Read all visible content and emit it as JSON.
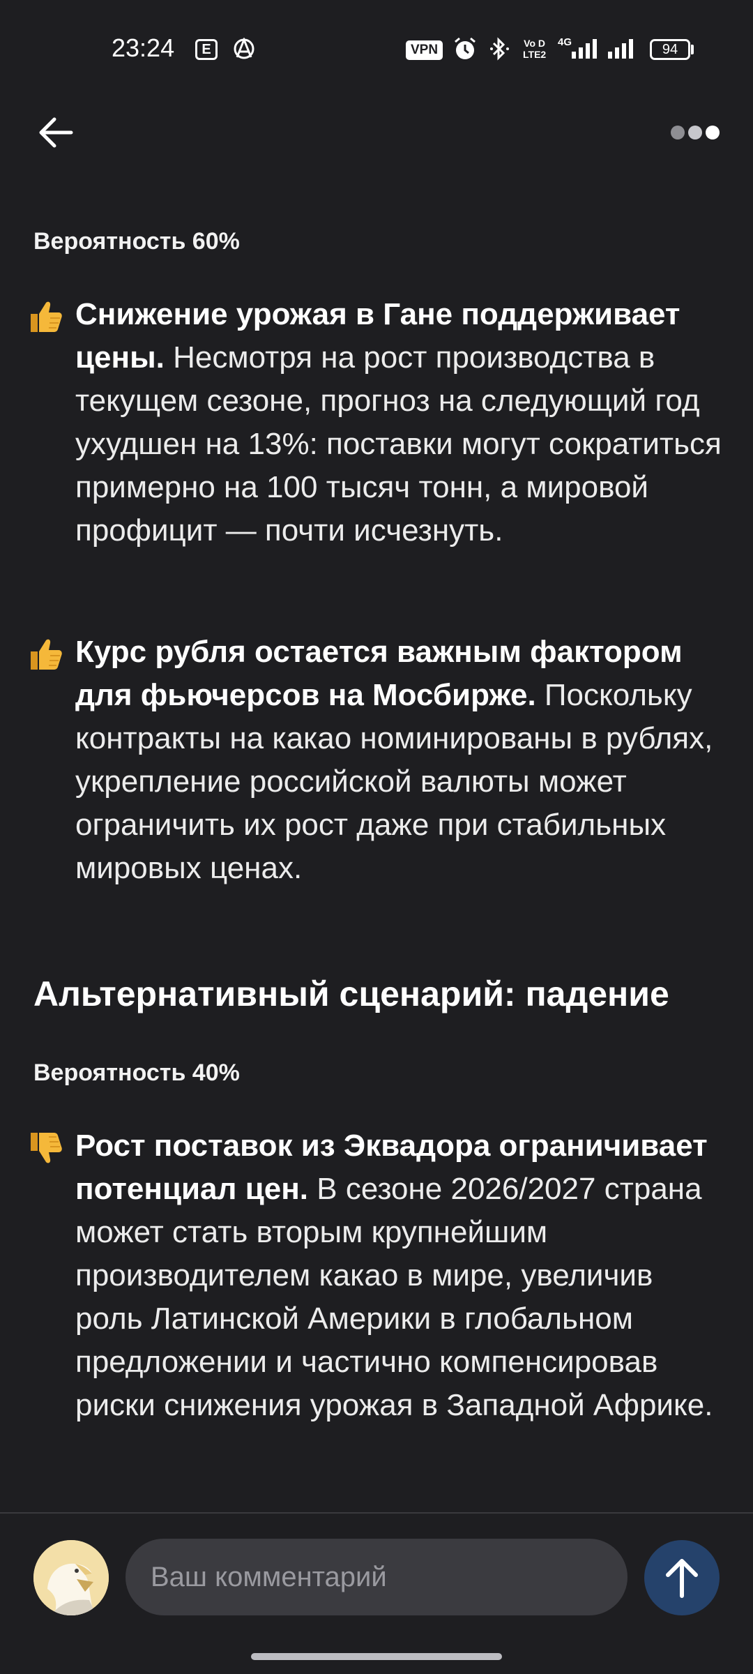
{
  "status_bar": {
    "time": "23:24",
    "notif_e": "E",
    "vpn": "VPN",
    "volte_top": "Vo D",
    "volte_bottom": "LTE2",
    "network": "4G",
    "battery": "94"
  },
  "icons": {
    "back": "arrow-left-icon",
    "more": "more-dots-icon",
    "thumbs_up": "thumbs-up-icon",
    "thumbs_down": "thumbs-down-icon",
    "send": "arrow-up-icon"
  },
  "article": {
    "probability_1": "Вероятность 60%",
    "points_up": [
      {
        "bold": "Снижение урожая в Гане поддерживает цены.",
        "text": " Несмотря на рост производства в текущем сезоне, прогноз на следующий год ухудшен на 13%: поставки могут сократиться примерно на 100 тысяч тонн, а мировой профицит — почти исчезнуть."
      },
      {
        "bold": "Курс рубля остается важным фактором для фьючерсов на Мосбирже.",
        "text": " Поскольку контракты на какао номинированы в рублях, укрепление российской валюты может ограничить их рост даже при стабильных мировых ценах."
      }
    ],
    "heading_alt": "Альтернативный сценарий: падение",
    "probability_2": "Вероятность 40%",
    "points_down": [
      {
        "bold": "Рост поставок из Эквадора ограничивает потенциал цен.",
        "text": " В сезоне 2026/2027 страна может стать вторым крупнейшим производителем какао в мире, увеличив роль Латинской Америки в глобальном предложении и частично компенсировав риски снижения урожая в Западной Африке."
      }
    ]
  },
  "comment": {
    "placeholder": "Ваш комментарий"
  },
  "colors": {
    "background": "#1e1e21",
    "send_button": "#25426b",
    "input_bg": "#3b3b40",
    "thumb_emoji": "#f5b83a"
  }
}
